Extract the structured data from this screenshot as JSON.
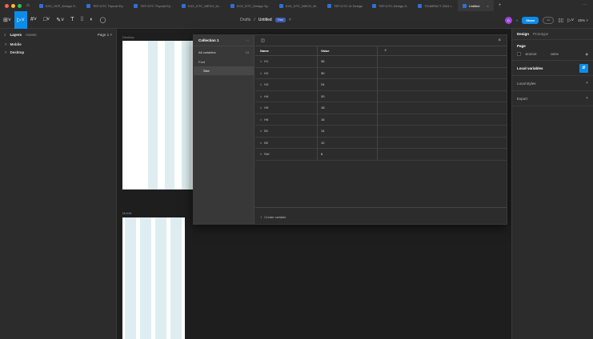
{
  "titlebar": {
    "tabs": [
      {
        "label": "KXX_HCP_Design S.."
      },
      {
        "label": "TEP-DTC Thyroid Ey.."
      },
      {
        "label": "TEP-DTC Thyroid Ey.."
      },
      {
        "label": "KXX_DTC_MECH_Dr.."
      },
      {
        "label": "KXX_DTC_Design Sy.."
      },
      {
        "label": "KXX_DTC_MECH_W.."
      },
      {
        "label": "TEP-DTC UI Design"
      },
      {
        "label": "TEP-DTC-Design-S.."
      },
      {
        "label": "TEIIMPACT 2024 I.."
      },
      {
        "label": "Untitled"
      }
    ],
    "close_glyph": "×",
    "plus_glyph": "+",
    "more_glyph": "···",
    "home_glyph": "⌂"
  },
  "toolbar": {
    "tools": [
      {
        "glyph": "⊞˅"
      },
      {
        "glyph": "▷˅"
      },
      {
        "glyph": "#˅"
      },
      {
        "glyph": "□˅"
      },
      {
        "glyph": "✎˅"
      },
      {
        "glyph": "T"
      },
      {
        "glyph": "⁞⁞"
      },
      {
        "glyph": "◐"
      },
      {
        "glyph": "◯"
      }
    ],
    "breadcrumb_root": "Drafts",
    "breadcrumb_sep": "/",
    "file_name": "Untitled",
    "plan_badge": "Free",
    "caret": "˅",
    "avatar_initial": "D",
    "share_label": "Share",
    "ring_label": "AA",
    "book_glyph": "▯▯",
    "play_glyph": "▷˅",
    "zoom": "45% ˅"
  },
  "left_panel": {
    "layers_tab": "Layers",
    "assets_tab": "Assets",
    "page_selector": "Page 1 ˅",
    "layers": [
      {
        "name": "Mobile"
      },
      {
        "name": "Desktop"
      }
    ],
    "hash_glyph": "#"
  },
  "canvas": {
    "desktop_label": "Desktop",
    "mobile_label": "Mobile"
  },
  "variables_modal": {
    "collection_name": "Collection 1",
    "collection_menu": "···",
    "all_variables_label": "All variables",
    "all_variables_count": "10",
    "group_label": "Font",
    "subgroup_label": "Size",
    "panel_icon": "◫",
    "close_glyph": "×",
    "col_name": "Name",
    "col_value": "Value",
    "add_col": "+",
    "rows": [
      {
        "name": "H1",
        "value": "36"
      },
      {
        "name": "H2",
        "value": "30"
      },
      {
        "name": "H3",
        "value": "24"
      },
      {
        "name": "H4",
        "value": "20"
      },
      {
        "name": "H5",
        "value": "18"
      },
      {
        "name": "H6",
        "value": "16"
      },
      {
        "name": "B1",
        "value": "14"
      },
      {
        "name": "B2",
        "value": "12"
      },
      {
        "name": "Ref",
        "value": "8"
      }
    ],
    "create_label": "Create variable",
    "create_plus": "+",
    "hash_glyph": "#"
  },
  "right_panel": {
    "design_tab": "Design",
    "prototype_tab": "Prototype",
    "page_label": "Page",
    "page_color": "1E1E1E",
    "page_opacity": "100%",
    "eye_glyph": "◉",
    "local_variables_label": "Local variables",
    "local_variables_btn": "⇵",
    "local_styles_label": "Local styles",
    "export_label": "Export",
    "plus_glyph": "+"
  },
  "colors": {
    "accent": "#0c8ce9",
    "canvas_bg": "#1e1e1e",
    "panel_bg": "#2c2c2c",
    "grid_column": "#deeef0"
  }
}
